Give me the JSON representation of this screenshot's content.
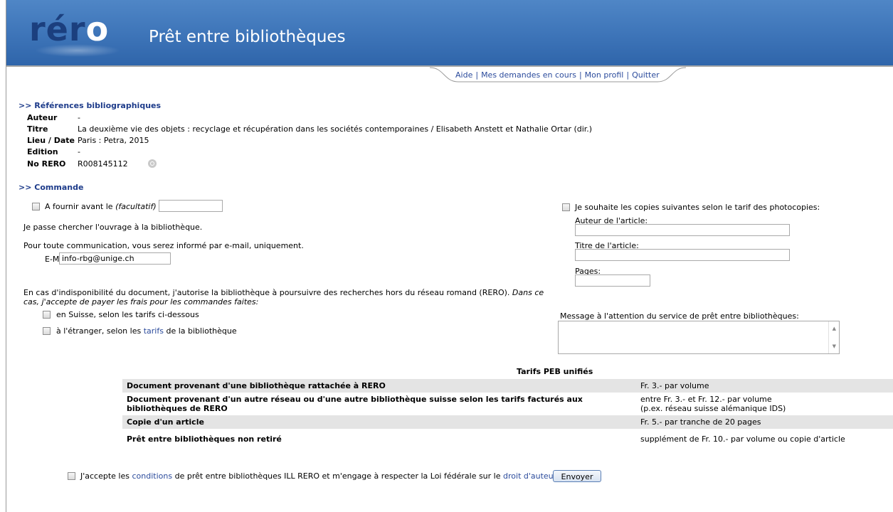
{
  "header": {
    "logo_prefix": "rér",
    "logo_suffix": "o",
    "title": "Prêt entre bibliothèques"
  },
  "menu": {
    "items": [
      "Aide",
      "Mes demandes en cours",
      "Mon profil",
      "Quitter"
    ],
    "separator": "|"
  },
  "references": {
    "section_title": ">> Références bibliographiques",
    "rows": [
      {
        "label": "Auteur",
        "value": "-"
      },
      {
        "label": "Titre",
        "value": "La deuxième vie des objets : recyclage et récupération dans les sociétés contemporaines / Elisabeth Anstett et Nathalie Ortar (dir.)"
      },
      {
        "label": "Lieu / Date",
        "value": "Paris : Petra, 2015"
      },
      {
        "label": "Edition",
        "value": "-"
      },
      {
        "label": "No RERO",
        "value": "R008145112"
      }
    ]
  },
  "order": {
    "section_title": ">> Commande",
    "deliver_before_label": "A fournir avant le",
    "deliver_before_optional": "(facultatif)",
    "deliver_before_value": "",
    "pickup_text": "Je passe chercher l'ouvrage à la bibliothèque.",
    "communication_text": "Pour toute communication, vous serez informé par e-mail, uniquement.",
    "email_label": "E-Mail",
    "email_value": "info-rbg@unige.ch",
    "unavailable_text_1": "En cas d'indisponibilité du document, j'autorise la bibliothèque à poursuivre des recherches hors du réseau romand (RERO).",
    "unavailable_text_italic_1": "Dans ce",
    "unavailable_text_italic_2": "cas, j'accepte de payer les frais pour les commandes faites:",
    "switzerland_label": "en Suisse, selon les tarifs ci-dessous",
    "abroad_label_1": "à l'étranger, selon les",
    "abroad_link": "tarifs",
    "abroad_label_2": "de la bibliothèque",
    "copies_label": "Je souhaite les copies suivantes selon le tarif des photocopies:",
    "article_author_label": "Auteur de l'article:",
    "article_author_value": "",
    "article_title_label": "Titre de l'article:",
    "article_title_value": "",
    "pages_label": "Pages:",
    "pages_value": "",
    "message_label": "Message à l'attention du service de prêt entre bibliothèques:",
    "message_value": ""
  },
  "tarifs": {
    "title": "Tarifs PEB unifiés",
    "rows": [
      {
        "desc": "Document provenant d'une bibliothèque rattachée à RERO",
        "price": "Fr. 3.- par volume",
        "price2": ""
      },
      {
        "desc": "Document provenant d'un autre réseau ou d'une autre bibliothèque suisse selon les tarifs facturés aux bibliothèques de RERO",
        "price": "entre Fr. 3.- et Fr. 12.- par volume",
        "price2": "(p.ex. réseau suisse alémanique IDS)"
      },
      {
        "desc": "Copie d'un article",
        "price": "Fr. 5.- par tranche de 20 pages",
        "price2": ""
      },
      {
        "desc": "Prêt entre bibliothèques non retiré",
        "price": "supplément de Fr. 10.- par volume ou copie d'article",
        "price2": ""
      }
    ]
  },
  "footer": {
    "accept_1": "J'accepte les",
    "conditions_link": "conditions",
    "accept_2": "de prêt entre bibliothèques ILL RERO et m'engage à respecter la Loi fédérale sur le",
    "copyright_link": "droit d'auteur",
    "accept_3": ".",
    "submit_label": "Envoyer"
  }
}
